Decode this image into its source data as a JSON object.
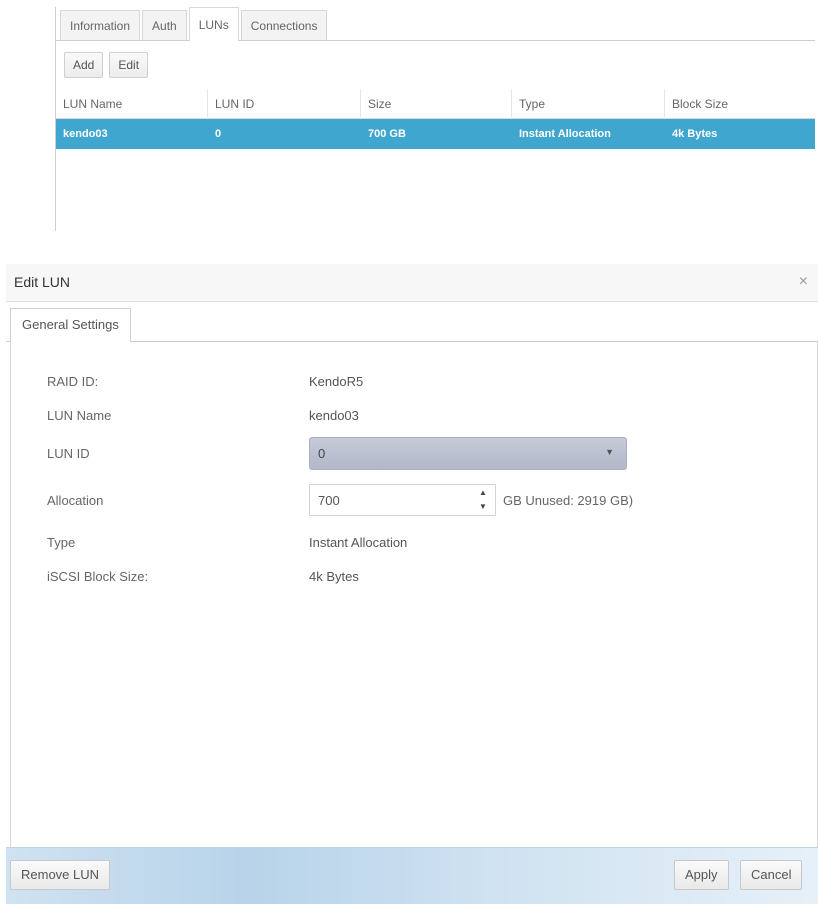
{
  "top": {
    "tabs": [
      "Information",
      "Auth",
      "LUNs",
      "Connections"
    ],
    "active_tab": "LUNs",
    "toolbar": {
      "add_label": "Add",
      "edit_label": "Edit"
    },
    "table": {
      "columns": [
        "LUN Name",
        "LUN ID",
        "Size",
        "Type",
        "Block Size"
      ],
      "rows": [
        {
          "name": "kendo03",
          "id": "0",
          "size": "700 GB",
          "type": "Instant Allocation",
          "block": "4k Bytes",
          "selected": true
        }
      ]
    }
  },
  "dialog": {
    "title": "Edit LUN",
    "close_glyph": "×",
    "tab": "General Settings",
    "fields": {
      "raid_id_label": "RAID ID:",
      "raid_id_value": "KendoR5",
      "lun_name_label": "LUN Name",
      "lun_name_value": "kendo03",
      "lun_id_label": "LUN ID",
      "lun_id_value": "0",
      "allocation_label": "Allocation",
      "allocation_value": "700",
      "allocation_unit": "GB Unused: 2919 GB)",
      "type_label": "Type",
      "type_value": "Instant Allocation",
      "block_size_label": "iSCSI Block Size:",
      "block_size_value": "4k Bytes"
    },
    "buttons": {
      "remove_label": "Remove LUN",
      "apply_label": "Apply",
      "cancel_label": "Cancel"
    }
  },
  "icons": {
    "caret": "chevron-down-icon",
    "spinner_up": "arrow-up-icon",
    "spinner_down": "arrow-down-icon"
  },
  "colors": {
    "selected_row": "#3fa7cf",
    "select_bg": "#b9bdcd",
    "footer": "#c4daee"
  }
}
